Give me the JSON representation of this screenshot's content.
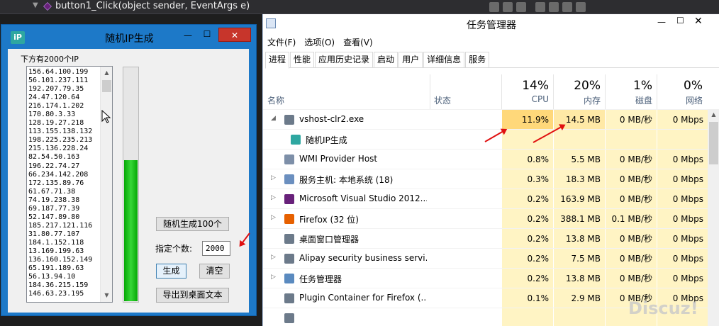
{
  "vs": {
    "method_name": "button1_Click(object sender, EventArgs e)"
  },
  "ip_window": {
    "icon_text": "iP",
    "title": "随机IP生成",
    "min": "—",
    "max": "☐",
    "close": "✕",
    "caption": "下方有2000个IP",
    "ips": [
      "156.64.100.199",
      "56.101.237.111",
      "192.207.79.35",
      "24.47.120.64",
      "216.174.1.202",
      "170.80.3.33",
      "128.19.27.218",
      "113.155.138.132",
      "198.225.235.213",
      "215.136.228.24",
      "82.54.50.163",
      "196.22.74.27",
      "66.234.142.208",
      "172.135.89.76",
      "61.67.71.38",
      "74.19.238.38",
      "69.187.77.39",
      "52.147.89.80",
      "185.217.121.116",
      "31.80.77.107",
      "184.1.152.118",
      "13.169.199.63",
      "136.160.152.149",
      "65.191.189.63",
      "56.13.94.10",
      "184.36.215.159",
      "146.63.23.195"
    ],
    "progress": 0.6,
    "btn_random100": "随机生成100个",
    "count_label": "指定个数:",
    "count_value": "2000",
    "btn_generate": "生成",
    "btn_clear": "清空",
    "btn_export": "导出到桌面文本"
  },
  "task_manager": {
    "title": "任务管理器",
    "menu": [
      "文件(F)",
      "选项(O)",
      "查看(V)"
    ],
    "tabs": [
      "进程",
      "性能",
      "应用历史记录",
      "启动",
      "用户",
      "详细信息",
      "服务"
    ],
    "active_tab": 0,
    "columns": {
      "name": "名称",
      "status": "状态",
      "cpu_pct": "14%",
      "cpu": "CPU",
      "mem_pct": "20%",
      "mem": "内存",
      "disk_pct": "1%",
      "disk": "磁盘",
      "net_pct": "0%",
      "net": "网络"
    },
    "rows": [
      {
        "name": "vshost-clr2.exe",
        "expander": "◢",
        "cpu": "11.9%",
        "mem": "14.5 MB",
        "disk": "0 MB/秒",
        "net": "0 Mbps",
        "icon": "window-icon",
        "iconColor": "#6c7a8a"
      },
      {
        "name": "随机IP生成",
        "expander": "",
        "cpu": "",
        "mem": "",
        "disk": "",
        "net": "",
        "icon": "ip-app-icon",
        "iconColor": "#2ea7a1",
        "child": true
      },
      {
        "name": "WMI Provider Host",
        "expander": "",
        "cpu": "0.8%",
        "mem": "5.5 MB",
        "disk": "0 MB/秒",
        "net": "0 Mbps",
        "icon": "wmi-icon",
        "iconColor": "#7d8fa8"
      },
      {
        "name": "服务主机: 本地系统 (18)",
        "expander": "▷",
        "cpu": "0.3%",
        "mem": "18.3 MB",
        "disk": "0 MB/秒",
        "net": "0 Mbps",
        "icon": "gear-icon",
        "iconColor": "#6b8fbf"
      },
      {
        "name": "Microsoft Visual Studio 2012...",
        "expander": "▷",
        "cpu": "0.2%",
        "mem": "163.9 MB",
        "disk": "0 MB/秒",
        "net": "0 Mbps",
        "icon": "visual-studio-icon",
        "iconColor": "#68217a"
      },
      {
        "name": "Firefox (32 位)",
        "expander": "▷",
        "cpu": "0.2%",
        "mem": "388.1 MB",
        "disk": "0.1 MB/秒",
        "net": "0 Mbps",
        "icon": "firefox-icon",
        "iconColor": "#e66000"
      },
      {
        "name": "桌面窗口管理器",
        "expander": "",
        "cpu": "0.2%",
        "mem": "13.8 MB",
        "disk": "0 MB/秒",
        "net": "0 Mbps",
        "icon": "window-icon",
        "iconColor": "#6c7a8a"
      },
      {
        "name": "Alipay security business servi...",
        "expander": "▷",
        "cpu": "0.2%",
        "mem": "7.5 MB",
        "disk": "0 MB/秒",
        "net": "0 Mbps",
        "icon": "window-icon",
        "iconColor": "#6c7a8a"
      },
      {
        "name": "任务管理器",
        "expander": "▷",
        "cpu": "0.2%",
        "mem": "13.8 MB",
        "disk": "0 MB/秒",
        "net": "0 Mbps",
        "icon": "task-manager-icon",
        "iconColor": "#5a8abf"
      },
      {
        "name": "Plugin Container for Firefox (...",
        "expander": "",
        "cpu": "0.1%",
        "mem": "2.9 MB",
        "disk": "0 MB/秒",
        "net": "0 Mbps",
        "icon": "window-icon",
        "iconColor": "#6c7a8a"
      },
      {
        "name": "",
        "expander": "",
        "cpu": "",
        "mem": "",
        "disk": "",
        "net": "",
        "icon": "window-icon",
        "iconColor": "#6c7a8a"
      }
    ]
  },
  "watermark": "Discuz!"
}
